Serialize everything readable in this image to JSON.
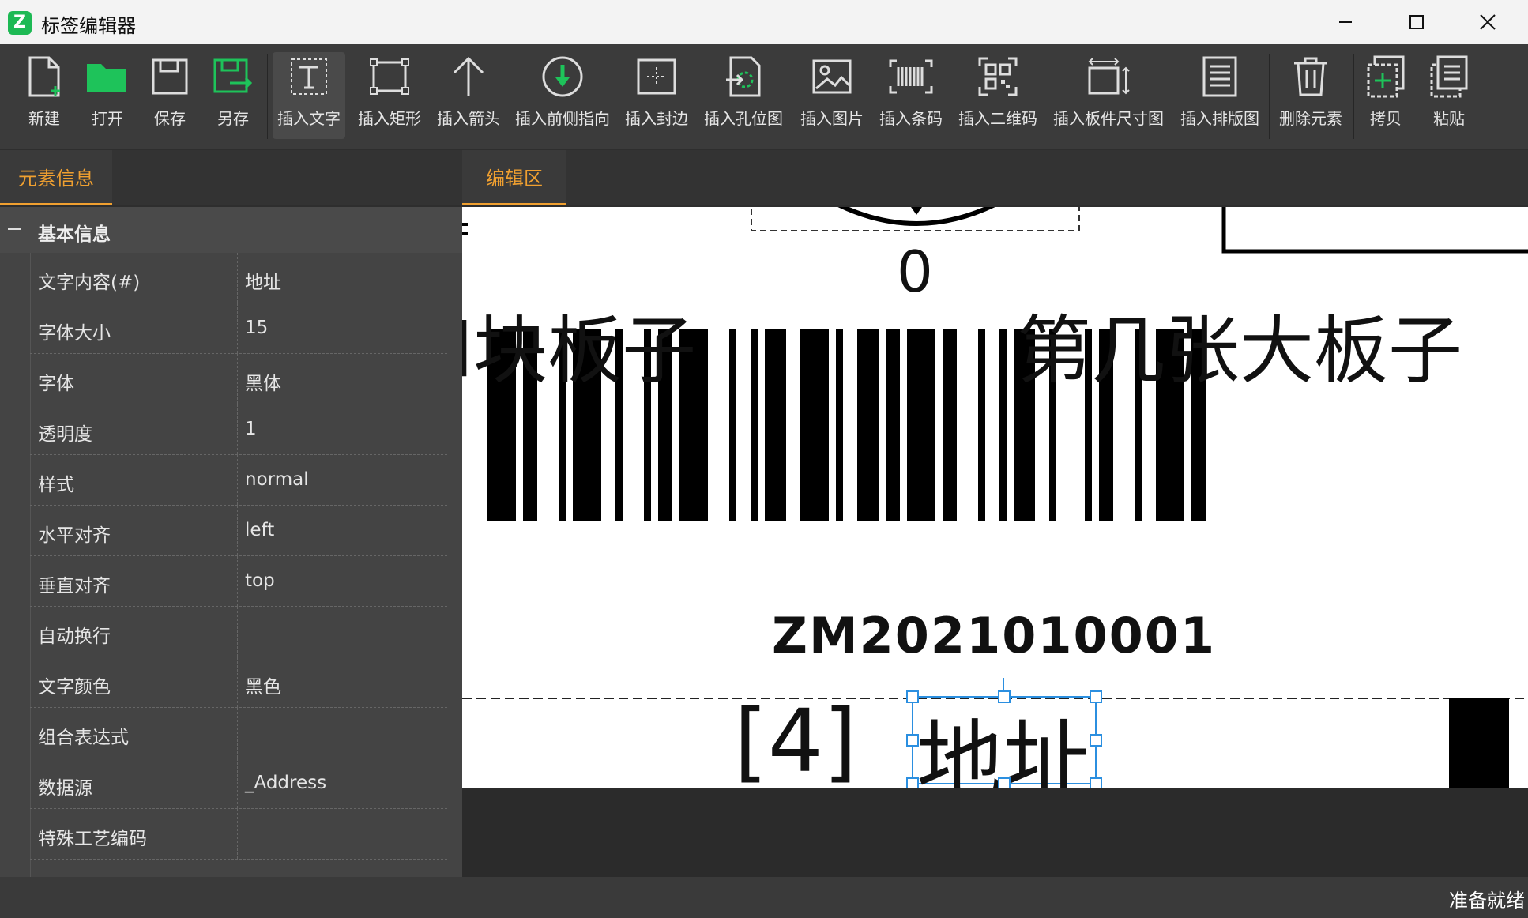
{
  "window": {
    "title": "标签编辑器",
    "logo_letter": "Z"
  },
  "toolbar": {
    "items": [
      {
        "label": "新建",
        "icon": "new-file-icon"
      },
      {
        "label": "打开",
        "icon": "folder-open-icon"
      },
      {
        "label": "保存",
        "icon": "save-icon"
      },
      {
        "label": "另存",
        "icon": "save-as-icon"
      },
      {
        "label": "插入文字",
        "icon": "insert-text-icon"
      },
      {
        "label": "插入矩形",
        "icon": "insert-rectangle-icon"
      },
      {
        "label": "插入箭头",
        "icon": "insert-arrow-icon"
      },
      {
        "label": "插入前侧指向",
        "icon": "insert-front-direction-icon"
      },
      {
        "label": "插入封边",
        "icon": "insert-edge-banding-icon"
      },
      {
        "label": "插入孔位图",
        "icon": "insert-hole-map-icon"
      },
      {
        "label": "插入图片",
        "icon": "insert-image-icon"
      },
      {
        "label": "插入条码",
        "icon": "insert-barcode-icon"
      },
      {
        "label": "插入二维码",
        "icon": "insert-qrcode-icon"
      },
      {
        "label": "插入板件尺寸图",
        "icon": "insert-panel-size-icon"
      },
      {
        "label": "插入排版图",
        "icon": "insert-layout-icon"
      },
      {
        "label": "删除元素",
        "icon": "delete-icon"
      },
      {
        "label": "拷贝",
        "icon": "copy-icon"
      },
      {
        "label": "粘贴",
        "icon": "paste-icon"
      }
    ]
  },
  "left_panel": {
    "tab": "元素信息",
    "section": "基本信息",
    "properties": [
      {
        "key": "文字内容(#)",
        "value": "地址"
      },
      {
        "key": "字体大小",
        "value": "15"
      },
      {
        "key": "字体",
        "value": "黑体"
      },
      {
        "key": "透明度",
        "value": "1"
      },
      {
        "key": "样式",
        "value": "normal"
      },
      {
        "key": "水平对齐",
        "value": "left"
      },
      {
        "key": "垂直对齐",
        "value": "top"
      },
      {
        "key": "自动换行",
        "value": ""
      },
      {
        "key": "文字颜色",
        "value": "黑色"
      },
      {
        "key": "组合表达式",
        "value": ""
      },
      {
        "key": "数据源",
        "value": "_Address"
      },
      {
        "key": "特殊工艺编码",
        "value": ""
      }
    ]
  },
  "editor": {
    "tab": "编辑区",
    "texts": {
      "zero": "0",
      "left_partial": "l块板子",
      "right_text": "第几张大板子",
      "barcode_text": "ZM2021010001",
      "bracket_text": "[4]",
      "selected_text": "地址"
    }
  },
  "status": {
    "text": "准备就绪"
  },
  "colors": {
    "accent": "#f0a030",
    "logo": "#1db954",
    "selection": "#2b8fe0"
  }
}
